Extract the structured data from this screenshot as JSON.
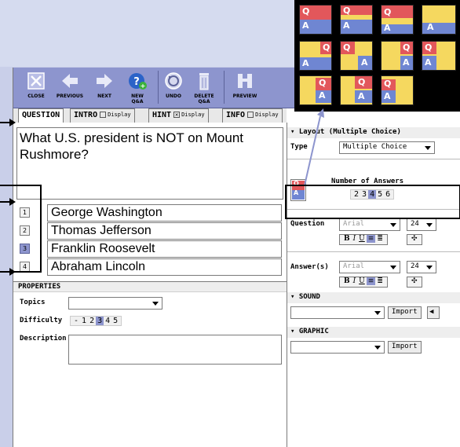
{
  "toolbar": {
    "buttons": [
      {
        "label": "CLOSE",
        "icon": "close-icon"
      },
      {
        "label": "PREVIOUS",
        "icon": "arrow-left-icon"
      },
      {
        "label": "NEXT",
        "icon": "arrow-right-icon"
      },
      {
        "label": "NEW Q&A",
        "icon": "new-qa-icon"
      },
      {
        "label": "UNDO",
        "icon": "undo-icon"
      },
      {
        "label": "DELETE Q&A",
        "icon": "trash-icon"
      },
      {
        "label": "PREVIEW",
        "icon": "preview-icon"
      }
    ]
  },
  "tabs": [
    {
      "label": "QUESTION",
      "display": null
    },
    {
      "label": "INTRO",
      "display": "Display",
      "checked": false
    },
    {
      "label": "HINT",
      "display": "Display",
      "checked": true
    },
    {
      "label": "INFO",
      "display": "Display",
      "checked": false
    }
  ],
  "question": {
    "text": "What U.S. president is NOT on Mount Rushmore?"
  },
  "answers": [
    {
      "num": "1",
      "text": "George Washington",
      "selected": false
    },
    {
      "num": "2",
      "text": "Thomas Jefferson",
      "selected": false
    },
    {
      "num": "3",
      "text": "Franklin Roosevelt",
      "selected": true
    },
    {
      "num": "4",
      "text": "Abraham Lincoln",
      "selected": false
    }
  ],
  "properties": {
    "header": "PROPERTIES",
    "topics_label": "Topics",
    "topics_value": "",
    "difficulty_label": "Difficulty",
    "difficulty_options": [
      "-",
      "1",
      "2",
      "3",
      "4",
      "5"
    ],
    "difficulty_selected": "3",
    "description_label": "Description",
    "description_value": ""
  },
  "layout": {
    "header": "Layout (Multiple Choice)",
    "type_label": "Type",
    "type_value": "Multiple Choice",
    "num_answers_label": "Number of Answers",
    "num_answers_options": [
      "2",
      "3",
      "4",
      "5",
      "6"
    ],
    "num_answers_selected": "4",
    "question_label": "Question",
    "question_font": "Arial",
    "question_size": "24",
    "answers_label": "Answer(s)",
    "answers_font": "Arial",
    "answers_size": "24",
    "format_buttons": [
      "B",
      "I",
      "U"
    ]
  },
  "sound": {
    "header": "SOUND",
    "value": "",
    "import_label": "Import"
  },
  "graphic": {
    "header": "GRAPHIC",
    "value": "",
    "import_label": "Import"
  },
  "layouts_popup": {
    "q": "Q",
    "a": "A"
  },
  "colors": {
    "toolbar": "#8d95ce",
    "accent": "#8d95ce",
    "tile_yellow": "#f5d85f",
    "tile_red": "#e2575b",
    "tile_blue": "#6f86d2"
  }
}
